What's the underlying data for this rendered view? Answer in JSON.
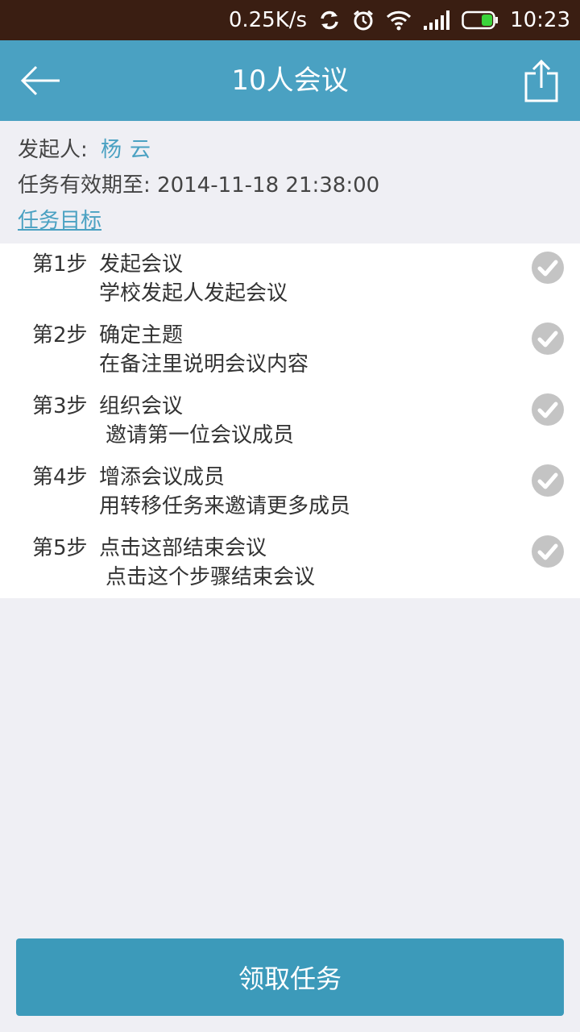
{
  "status_bar": {
    "net_speed": "0.25K/s",
    "time": "10:23",
    "icons": [
      "sync-icon",
      "alarm-icon",
      "wifi-icon",
      "signal-icon",
      "battery-icon"
    ]
  },
  "app_bar": {
    "title": "10人会议",
    "back_icon": "arrow-left-icon",
    "share_icon": "share-icon"
  },
  "info": {
    "initiator_label": "发起人: ",
    "initiator_name": "杨云",
    "deadline_label": "任务有效期至: ",
    "deadline_value": "2014-11-18 21:38:00",
    "goal_link": "任务目标"
  },
  "steps": [
    {
      "num": "第1步",
      "title": "发起会议",
      "desc": "学校发起人发起会议"
    },
    {
      "num": "第2步",
      "title": "确定主题",
      "desc": "在备注里说明会议内容"
    },
    {
      "num": "第3步",
      "title": "组织会议",
      "desc": "邀请第一位会议成员"
    },
    {
      "num": "第4步",
      "title": "增添会议成员",
      "desc": "用转移任务来邀请更多成员"
    },
    {
      "num": "第5步",
      "title": "点击这部结束会议",
      "desc": "点击这个步骤结束会议"
    }
  ],
  "action_button": {
    "label": "领取任务"
  },
  "colors": {
    "status_bar_bg": "#3a1e12",
    "app_bar_bg": "#4aa1c2",
    "accent": "#4aa1c2",
    "button_bg": "#3c9aba",
    "check_bg": "#c4c4c4",
    "page_bg": "#efeff4"
  }
}
